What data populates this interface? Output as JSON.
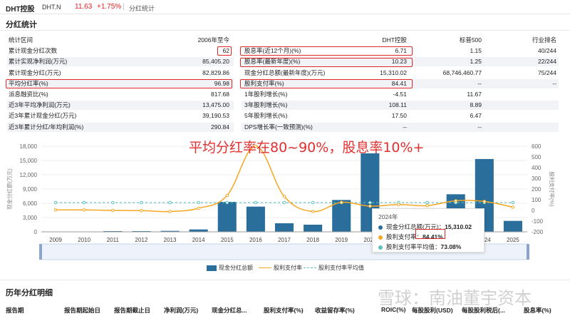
{
  "topbar": {
    "name": "DHT控股",
    "ticker": "DHT.N",
    "price": "11.63",
    "change": "+1.75%",
    "separator": "|",
    "tab": "分红统计"
  },
  "section_title": "分红统计",
  "left_table": {
    "header": {
      "label": "统计区间",
      "value": "2006年至今"
    },
    "rows": [
      {
        "label": "累计现金分红次数",
        "value": "62"
      },
      {
        "label": "累计实现净利润(万元)",
        "value": "85,405.20"
      },
      {
        "label": "累计现金分红(万元)",
        "value": "82,829.86"
      },
      {
        "label": "平均分红率(%)",
        "value": "96.98"
      },
      {
        "label": "派息融资比(%)",
        "value": "817.68"
      },
      {
        "label": "近3年平均净利润(万元)",
        "value": "13,475.00"
      },
      {
        "label": "近3年累计现金分红(万元)",
        "value": "39,190.53"
      },
      {
        "label": "近3年累计分红/年均利润(%)",
        "value": "290.84"
      }
    ]
  },
  "right_table": {
    "header": {
      "c1": "DHT控股",
      "c2": "标普500",
      "c3": "行业排名"
    },
    "rows": [
      {
        "label": "股息率(近12个月)(%)",
        "c1": "6.71",
        "c2": "1.15",
        "c3": "40/244"
      },
      {
        "label": "股息率(最新年度)(%)",
        "c1": "10.23",
        "c2": "1.25",
        "c3": "22/244"
      },
      {
        "label": "现金分红总额(最新年度)(万元)",
        "c1": "15,310.02",
        "c2": "68,746,460.77",
        "c3": "75/244"
      },
      {
        "label": "股利支付率(%)",
        "c1": "84.41",
        "c2": "--",
        "c3": "--"
      },
      {
        "label": "1年股利增长(%)",
        "c1": "-4.51",
        "c2": "11.67",
        "c3": ""
      },
      {
        "label": "3年股利增长(%)",
        "c1": "108.11",
        "c2": "8.89",
        "c3": ""
      },
      {
        "label": "5年股利增长(%)",
        "c1": "17.50",
        "c2": "6.47",
        "c3": ""
      },
      {
        "label": "DPS增长率(一致预测)(%)",
        "c1": "--",
        "c2": "--",
        "c3": ""
      }
    ]
  },
  "annotation": "平均分红率在80~90%，股息率10%+",
  "chart_data": {
    "type": "bar",
    "categories": [
      "2009",
      "2010",
      "2011",
      "2012",
      "2013",
      "2014",
      "2015",
      "2016",
      "2017",
      "2018",
      "2019",
      "2020",
      "2021",
      "2022",
      "2023",
      "2024",
      "2025"
    ],
    "series": [
      {
        "name": "现金分红总额",
        "type": "bar",
        "axis": "left",
        "values": [
          0,
          0,
          150,
          150,
          200,
          500,
          6300,
          5300,
          1800,
          1500,
          6700,
          16500,
          2000,
          700,
          7900,
          15310.02,
          2300
        ]
      },
      {
        "name": "股利支付率",
        "type": "line",
        "axis": "right",
        "values": [
          5,
          5,
          0,
          -2,
          -10,
          20,
          140,
          600,
          130,
          -10,
          75,
          40,
          55,
          45,
          90,
          84.41,
          30
        ]
      },
      {
        "name": "股利支付率平均值",
        "type": "line",
        "axis": "right",
        "values": [
          73.08,
          73.08,
          73.08,
          73.08,
          73.08,
          73.08,
          73.08,
          73.08,
          73.08,
          73.08,
          73.08,
          73.08,
          73.08,
          73.08,
          73.08,
          73.08,
          73.08
        ]
      }
    ],
    "ylabel_left": "现金分红额(万元)",
    "ylabel_right": "股利支付率(%)",
    "ylim_left": [
      0,
      18000
    ],
    "ylim_right": [
      -200,
      600
    ],
    "yticks_left": [
      "0",
      "3,000",
      "6,000",
      "9,000",
      "12,000",
      "15,000",
      "18,000"
    ],
    "yticks_right": [
      "-200",
      "-100",
      "0",
      "100",
      "200",
      "300",
      "400",
      "500",
      "600"
    ],
    "colors": {
      "bar": "#2a6f9b",
      "line": "#f5a623",
      "avg": "#5bc0be"
    },
    "legend": [
      "现金分红总额",
      "股利支付率",
      "股利支付率平均值"
    ],
    "tooltip": {
      "year": "2024年",
      "rows": [
        {
          "label": "现金分红总额(万元)：",
          "value": "15,310.02",
          "color": "#2a6f9b"
        },
        {
          "label": "股利支付率：",
          "value": "84.41%",
          "color": "#f5a623"
        },
        {
          "label": "股利支付率平均值：",
          "value": "73.08%",
          "color": "#5bc0be"
        }
      ]
    }
  },
  "history_title": "历年分红明细",
  "history_headers": [
    "报告期",
    "报告期起始日",
    "报告期截止日",
    "净利润(万元)",
    "现金分红总...",
    "股利支付率(%)",
    "收益留存率(%)",
    "ROIC(%)",
    "每股股利(USD)",
    "每股股利税后(...",
    "股息率(%)"
  ],
  "watermark": "雪球：南油董宇资本"
}
